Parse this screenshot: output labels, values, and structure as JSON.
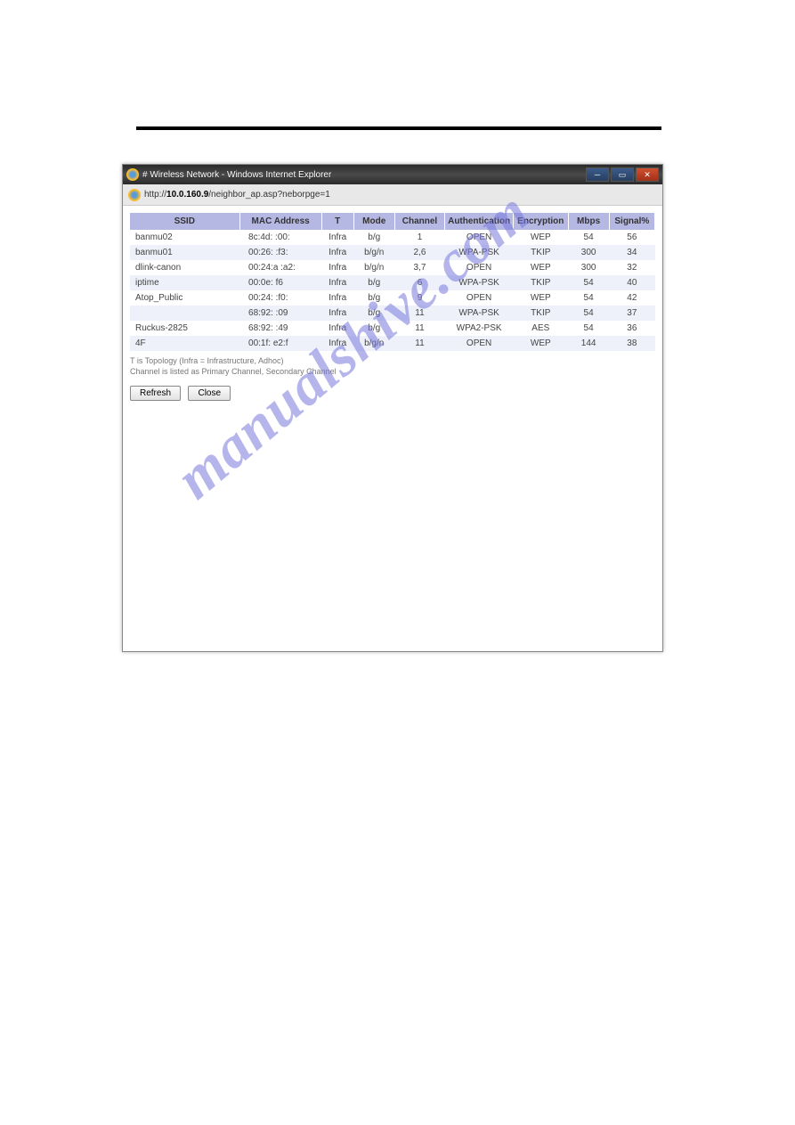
{
  "window": {
    "title": "# Wireless Network - Windows Internet Explorer",
    "url_prefix": "http://",
    "url_host": "10.0.160.9",
    "url_path": "/neighbor_ap.asp?neborpge=1"
  },
  "table": {
    "headers": {
      "ssid": "SSID",
      "mac": "MAC Address",
      "t": "T",
      "mode": "Mode",
      "channel": "Channel",
      "auth": "Authentication",
      "enc": "Encryption",
      "mbps": "Mbps",
      "signal": "Signal%"
    },
    "rows": [
      {
        "ssid": "banmu02",
        "mac": "8c:4d:   :00:",
        "t": "Infra",
        "mode": "b/g",
        "channel": "1",
        "auth": "OPEN",
        "enc": "WEP",
        "mbps": "54",
        "signal": "56"
      },
      {
        "ssid": "banmu01",
        "mac": "00:26:   :f3:",
        "t": "Infra",
        "mode": "b/g/n",
        "channel": "2,6",
        "auth": "WPA-PSK",
        "enc": "TKIP",
        "mbps": "300",
        "signal": "34"
      },
      {
        "ssid": "dlink-canon",
        "mac": "00:24:a  :a2:",
        "t": "Infra",
        "mode": "b/g/n",
        "channel": "3,7",
        "auth": "OPEN",
        "enc": "WEP",
        "mbps": "300",
        "signal": "32"
      },
      {
        "ssid": "iptime",
        "mac": "00:0e:   f6",
        "t": "Infra",
        "mode": "b/g",
        "channel": "6",
        "auth": "WPA-PSK",
        "enc": "TKIP",
        "mbps": "54",
        "signal": "40"
      },
      {
        "ssid": "Atop_Public",
        "mac": "00:24:   :f0:",
        "t": "Infra",
        "mode": "b/g",
        "channel": "9",
        "auth": "OPEN",
        "enc": "WEP",
        "mbps": "54",
        "signal": "42"
      },
      {
        "ssid": "",
        "mac": "68:92:   :09",
        "t": "Infra",
        "mode": "b/g",
        "channel": "11",
        "auth": "WPA-PSK",
        "enc": "TKIP",
        "mbps": "54",
        "signal": "37"
      },
      {
        "ssid": "Ruckus-2825",
        "mac": "68:92:   :49",
        "t": "Infra",
        "mode": "b/g",
        "channel": "11",
        "auth": "WPA2-PSK",
        "enc": "AES",
        "mbps": "54",
        "signal": "36"
      },
      {
        "ssid": "4F",
        "mac": "00:1f:   e2:f",
        "t": "Infra",
        "mode": "b/g/n",
        "channel": "11",
        "auth": "OPEN",
        "enc": "WEP",
        "mbps": "144",
        "signal": "38"
      }
    ]
  },
  "footnote": {
    "line1": "T is Topology (Infra = Infrastructure, Adhoc)",
    "line2": "Channel is listed as Primary Channel, Secondary Channel"
  },
  "buttons": {
    "refresh": "Refresh",
    "close": "Close"
  },
  "watermark": "manualshive.com"
}
